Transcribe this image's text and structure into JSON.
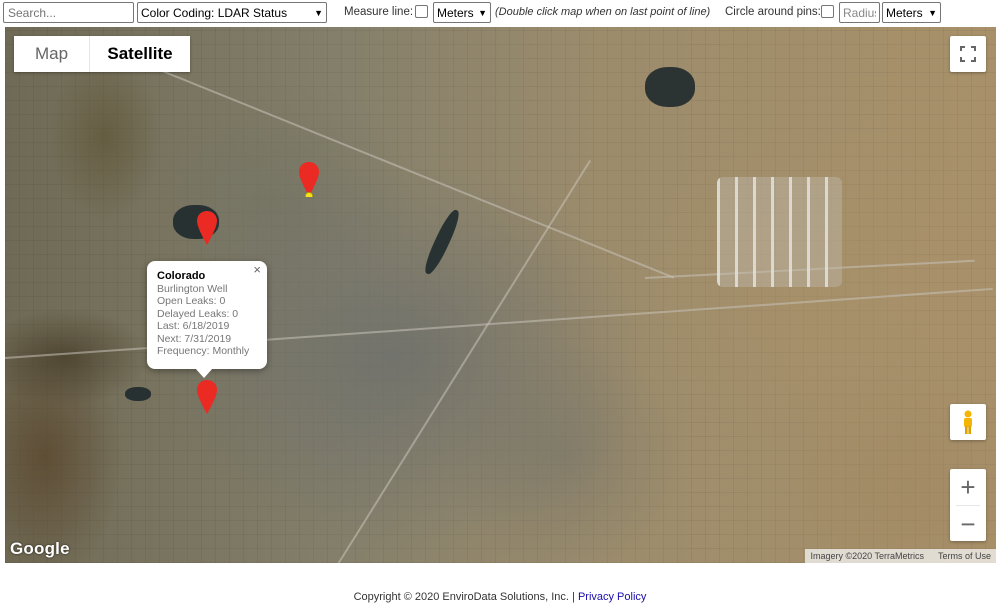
{
  "toolbar": {
    "search_placeholder": "Search...",
    "color_coding": "Color Coding: LDAR Status",
    "measure_label": "Measure line:",
    "measure_units": "Meters",
    "measure_hint": "(Double click map when on last point of line)",
    "circle_label": "Circle around pins:",
    "radius_placeholder": "Radius",
    "circle_units": "Meters"
  },
  "map": {
    "map_type_options": [
      "Map",
      "Satellite"
    ],
    "selected_map_type": "Satellite",
    "zoom_in": "+",
    "zoom_out": "−",
    "google_logo": "Google",
    "imagery_credit": "Imagery ©2020 TerraMetrics",
    "terms": "Terms of Use",
    "pin_color": "#ea2a23",
    "pins": [
      {
        "color": "#ea2a23",
        "has_dot": true
      },
      {
        "color": "#ea2a23",
        "has_dot": false
      },
      {
        "color": "#ea2a23",
        "has_dot": false
      }
    ]
  },
  "info_window": {
    "title": "Colorado",
    "lines": [
      "Burlington Well",
      "Open Leaks: 0",
      "Delayed Leaks: 0",
      "Last: 6/18/2019",
      "Next: 7/31/2019",
      "Frequency: Monthly"
    ],
    "close": "×"
  },
  "footer": {
    "copyright": "Copyright © 2020 EnviroData Solutions, Inc. | ",
    "privacy": "Privacy Policy"
  }
}
